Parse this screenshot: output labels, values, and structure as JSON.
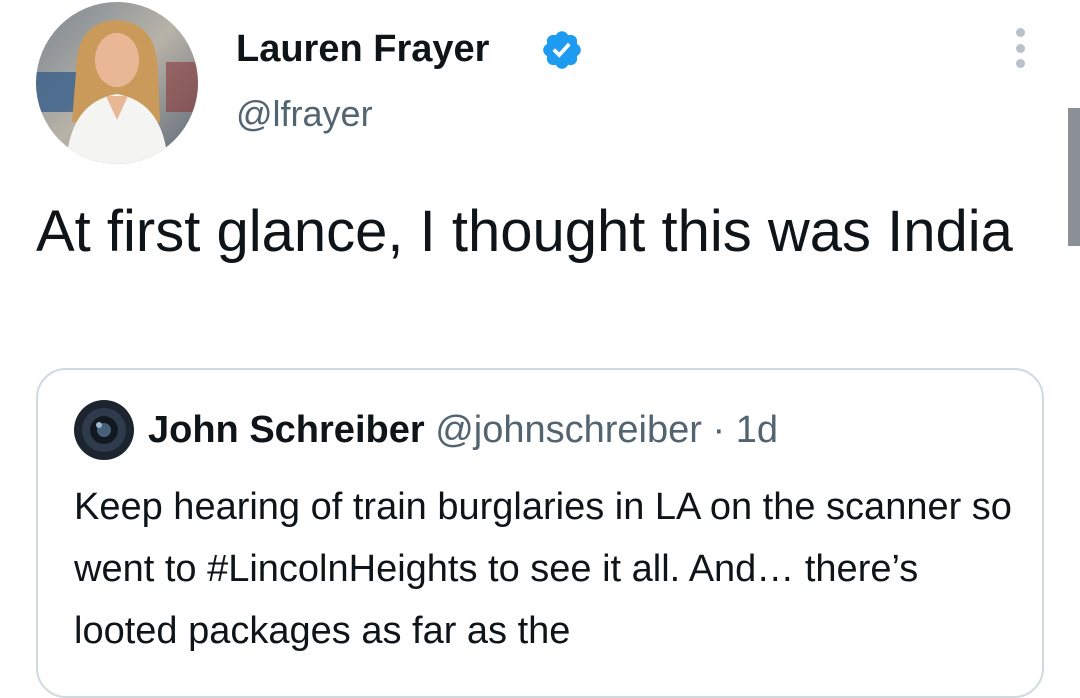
{
  "tweet": {
    "author_name": "Lauren Frayer",
    "author_handle": "@lfrayer",
    "text": "At first glance, I thought this was India",
    "verified_icon": "verified-badge-icon",
    "menu_icon": "more-vertical-icon"
  },
  "quote": {
    "author_name": "John Schreiber",
    "author_handle": "@johnschreiber",
    "separator": "·",
    "time": "1d",
    "text": "Keep hearing of train burglaries in LA on the scanner so went to #LincolnHeights to see it all. And… there’s looted packages as far as the"
  },
  "colors": {
    "text_primary": "#0f1419",
    "text_secondary": "#536471",
    "verified_blue": "#1d9bf0",
    "card_border": "#cfd9de"
  }
}
